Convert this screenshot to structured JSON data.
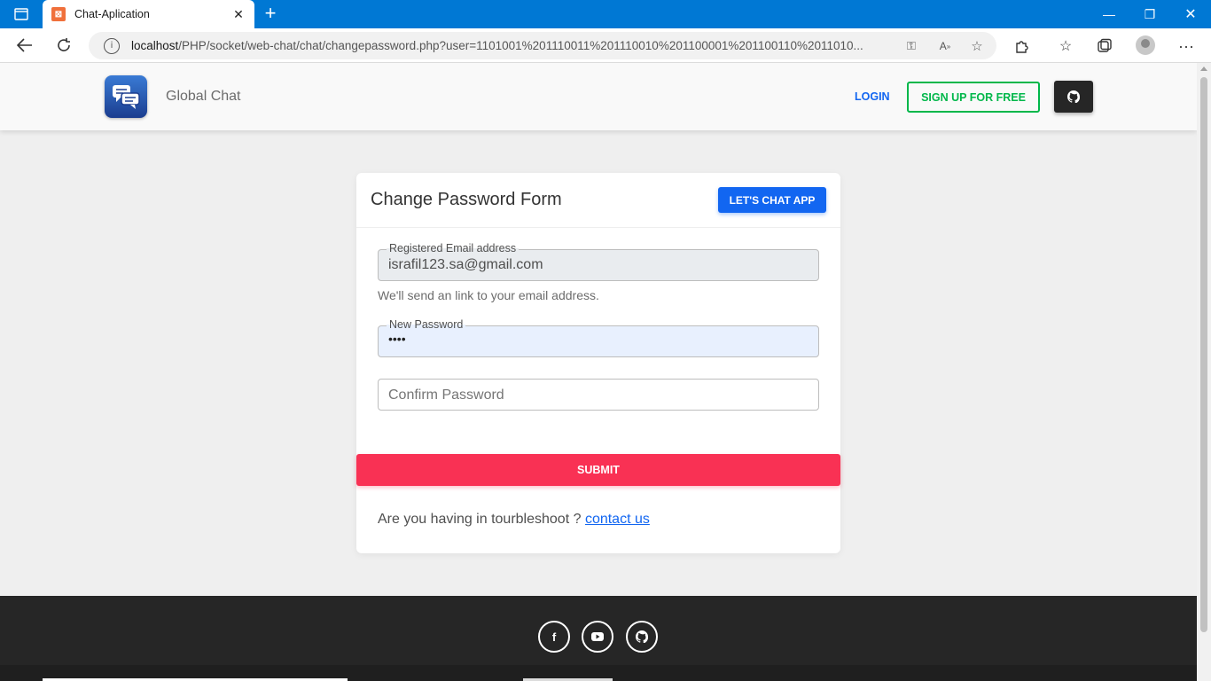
{
  "browser": {
    "tab_title": "Chat-Aplication",
    "url_host": "localhost",
    "url_path": "/PHP/socket/web-chat/chat/changepassword.php?user=1101001%201110011%201110010%201100001%201100110%2011010..."
  },
  "navbar": {
    "brand": "Global Chat",
    "login_label": "LOGIN",
    "signup_label": "SIGN UP FOR FREE"
  },
  "form": {
    "title": "Change Password Form",
    "chat_button_label": "LET'S CHAT APP",
    "email_label": "Registered Email address",
    "email_value": "israfil123.sa@gmail.com",
    "email_helper": "We'll send an link to your email address.",
    "password_label": "New Password",
    "password_value": "••••",
    "confirm_placeholder": "Confirm Password",
    "submit_label": "SUBMIT",
    "trouble_text": "Are you having in tourbleshoot ? ",
    "contact_link": "contact us"
  },
  "footer": {
    "social": [
      "facebook-icon",
      "youtube-icon",
      "github-icon"
    ]
  },
  "colors": {
    "primary": "#1266f1",
    "success": "#00b74a",
    "danger": "#f93154",
    "dark": "#262626",
    "titlebar": "#0078d4"
  }
}
